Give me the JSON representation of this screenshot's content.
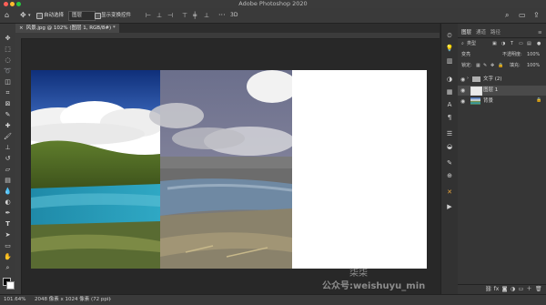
{
  "app": {
    "title": "Adobe Photoshop 2020"
  },
  "options_bar": {
    "auto_select_label": "自动选择",
    "auto_select_target": "图层",
    "show_transform_label": "显示变换控件"
  },
  "document_tab": {
    "label": "风景.jpg @ 102% (图层 1, RGB/8#) *"
  },
  "status": {
    "zoom": "101.64%",
    "doc_info": "2048 像素 x 1024 像素 (72 ppi)"
  },
  "layers_panel": {
    "tabs": [
      "图层",
      "通道",
      "路径"
    ],
    "filter_kind": "类型",
    "blend_mode": "变亮",
    "opacity_label": "不透明度:",
    "opacity_value": "100%",
    "lock_label": "锁定:",
    "fill_label": "填充:",
    "fill_value": "100%",
    "layers": [
      {
        "name": "文字 (2)",
        "type": "group"
      },
      {
        "name": "图层 1",
        "type": "layer",
        "selected": true
      },
      {
        "name": "背景",
        "type": "background"
      }
    ]
  },
  "tools": [
    "move-tool",
    "artboard-tool",
    "marquee-tool",
    "lasso-tool",
    "object-select-tool",
    "crop-tool",
    "frame-tool",
    "eyedropper-tool",
    "healing-tool",
    "brush-tool",
    "stamp-tool",
    "history-brush-tool",
    "eraser-tool",
    "gradient-tool",
    "blur-tool",
    "dodge-tool",
    "pen-tool",
    "type-tool",
    "path-select-tool",
    "rectangle-tool",
    "hand-tool",
    "zoom-tool",
    "more-tools"
  ],
  "colors": {
    "ui_bg": "#282828",
    "panel_bg": "#363636",
    "selected_layer": "#4a4a4a",
    "accent": "#e6a23c"
  },
  "watermark": {
    "line1": "柒柒",
    "line2": "公众号:weishuyu_min"
  }
}
